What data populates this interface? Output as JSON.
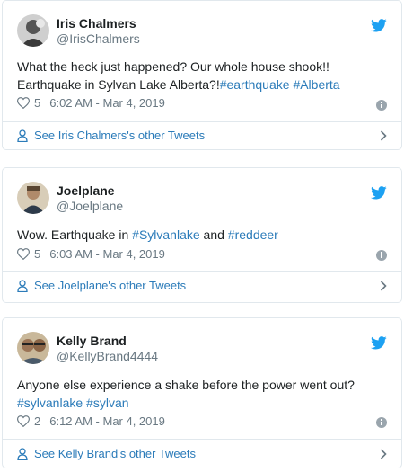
{
  "colors": {
    "link": "#2b7bb9",
    "twitter": "#1da1f2",
    "muted": "#697882",
    "border": "#e1e8ed"
  },
  "tweets": [
    {
      "name": "Iris Chalmers",
      "handle": "@IrisChalmers",
      "text_plain": "What the heck just happened? Our whole house shook!! Earthquake in Sylvan Lake Alberta?!",
      "hashtags": [
        "#earthquake",
        "#Alberta"
      ],
      "likes": "5",
      "time": "6:02 AM - Mar 4, 2019",
      "other_link": "See Iris Chalmers's other Tweets",
      "avatar_icon": "avatar-photo-icon"
    },
    {
      "name": "Joelplane",
      "handle": "@Joelplane",
      "text_before": "Wow. Earthquake in ",
      "hashtag1": "#Sylvanlake",
      "text_mid": " and ",
      "hashtag2": "#reddeer",
      "likes": "5",
      "time": "6:03 AM - Mar 4, 2019",
      "other_link": "See Joelplane's other Tweets",
      "avatar_icon": "avatar-photo-icon"
    },
    {
      "name": "Kelly Brand",
      "handle": "@KellyBrand4444",
      "text_plain": "Anyone else experience a shake before the power went out?",
      "hashtags": [
        "#sylvanlake",
        "#sylvan"
      ],
      "likes": "2",
      "time": "6:12 AM - Mar 4, 2019",
      "other_link": "See Kelly Brand's other Tweets",
      "avatar_icon": "avatar-photo-icon"
    }
  ]
}
